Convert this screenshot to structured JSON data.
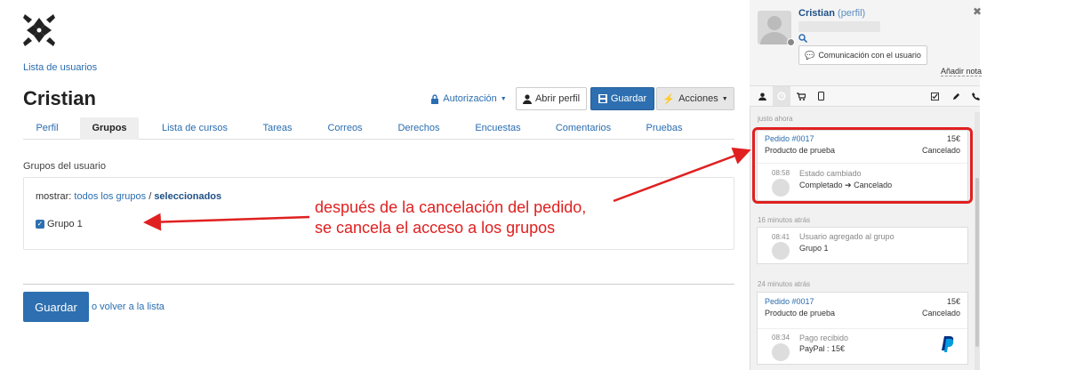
{
  "main": {
    "breadcrumb": "Lista de usuarios",
    "title": "Cristian",
    "toolbar": {
      "authorization": "Autorización",
      "open_profile": "Abrir perfil",
      "save": "Guardar",
      "actions": "Acciones"
    },
    "tabs": [
      {
        "label": "Perfil",
        "active": false
      },
      {
        "label": "Grupos",
        "active": true
      },
      {
        "label": "Lista de cursos",
        "active": false
      },
      {
        "label": "Tareas",
        "active": false
      },
      {
        "label": "Correos",
        "active": false
      },
      {
        "label": "Derechos",
        "active": false
      },
      {
        "label": "Encuestas",
        "active": false
      },
      {
        "label": "Comentarios",
        "active": false
      },
      {
        "label": "Pruebas",
        "active": false
      }
    ],
    "section_title": "Grupos del usuario",
    "filter": {
      "prefix": "mostrar:",
      "all": "todos los grupos",
      "separator": "/",
      "selected": "seleccionados"
    },
    "groups": [
      {
        "label": "Grupo 1",
        "checked": true
      }
    ],
    "save_bottom": "Guardar",
    "back_link": "o volver a la lista"
  },
  "annotation": {
    "line1": "después de la cancelación del pedido,",
    "line2": "se cancela el acceso a los grupos",
    "color": "#e02020"
  },
  "sidebar": {
    "user_name": "Cristian",
    "profile_link": "(perfil)",
    "communication_button": "Comunicación con el usuario",
    "add_note": "Añadir nota",
    "timeline": [
      {
        "time_label": "justo ahora",
        "order": "Pedido #0017",
        "amount": "15€",
        "product": "Producto de prueba",
        "status": "Cancelado",
        "event": {
          "time": "08:58",
          "title": "Estado cambiado",
          "from": "Completado",
          "to": "Cancelado"
        }
      },
      {
        "time_label": "16 minutos atrás",
        "event": {
          "time": "08:41",
          "title": "Usuario agregado al grupo",
          "detail": "Grupo 1"
        }
      },
      {
        "time_label": "24 minutos atrás",
        "order": "Pedido #0017",
        "amount": "15€",
        "product": "Producto de prueba",
        "status": "Cancelado",
        "event": {
          "time": "08:34",
          "title": "Pago recibido",
          "detail": "PayPal : 15€"
        }
      }
    ]
  },
  "colors": {
    "primary": "#2d6fb0",
    "link": "#2a6db0",
    "highlight": "#e02020"
  }
}
